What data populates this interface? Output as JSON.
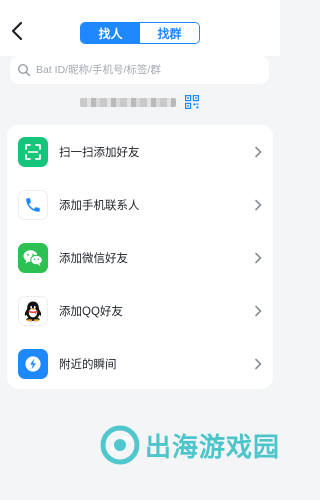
{
  "header": {
    "tabs": [
      {
        "label": "找人",
        "active": true
      },
      {
        "label": "找群",
        "active": false
      }
    ]
  },
  "search": {
    "placeholder": "Bat ID/昵称/手机号/标签/群"
  },
  "menu": {
    "items": [
      {
        "label": "扫一扫添加好友",
        "icon": "scan-icon"
      },
      {
        "label": "添加手机联系人",
        "icon": "phone-icon"
      },
      {
        "label": "添加微信好友",
        "icon": "wechat-icon"
      },
      {
        "label": "添加QQ好友",
        "icon": "qq-icon"
      },
      {
        "label": "附近的瞬间",
        "icon": "lightning-icon"
      }
    ]
  },
  "watermark": {
    "text": "出海游戏园"
  },
  "colors": {
    "accent": "#1e88ff",
    "scan": "#16c47c",
    "wechat": "#2ec052",
    "background": "#f4f5f7"
  }
}
